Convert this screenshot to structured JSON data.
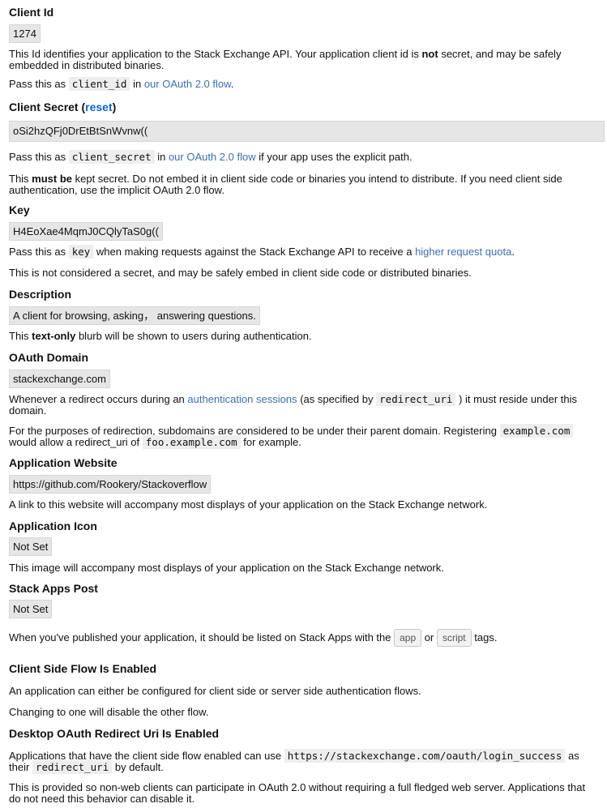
{
  "client_id": {
    "heading": "Client Id",
    "value": "1274",
    "desc_pre": "This Id identifies your application to the Stack Exchange API. Your application client id is ",
    "desc_bold": "not",
    "desc_post": " secret, and may be safely embedded in distributed binaries.",
    "pass_pre": "Pass this as",
    "pass_code": "client_id",
    "pass_in": "in",
    "pass_link": "our OAuth 2.0 flow",
    "pass_end": "."
  },
  "client_secret": {
    "heading": "Client Secret (",
    "reset_label": "reset",
    "heading_close": ")",
    "value": "oSi2hzQFj0DrEtBtSnWvnw((",
    "pass_pre": "Pass this as",
    "pass_code": "client_secret",
    "pass_in": "in",
    "pass_link": "our OAuth 2.0 flow",
    "pass_end": "if your app uses the explicit path.",
    "note_pre": "This ",
    "note_bold": "must be",
    "note_post": " kept secret. Do not embed it in client side code or binaries you intend to distribute. If you need client side authentication, use the implicit OAuth 2.0 flow."
  },
  "key": {
    "heading": "Key",
    "value": "H4EoXae4MqmJ0CQlyTaS0g((",
    "pass_pre": "Pass this as",
    "pass_code": "key",
    "pass_mid": "when making requests against the Stack Exchange API to receive a",
    "pass_link": "higher request quota",
    "pass_end": ".",
    "note": "This is not considered a secret, and may be safely embed in client side code or distributed binaries."
  },
  "description": {
    "heading": "Description",
    "value": "A client for browsing, asking， answering questions.",
    "note_pre": "This ",
    "note_bold": "text-only",
    "note_post": " blurb will be shown to users during authentication."
  },
  "oauth_domain": {
    "heading": "OAuth Domain",
    "value": "stackexchange.com",
    "p1_pre": "Whenever a redirect occurs during an",
    "p1_link": "authentication sessions",
    "p1_mid": "(as specified by",
    "p1_code": "redirect_uri",
    "p1_post": ") it must reside under this domain.",
    "p2_pre": "For the purposes of redirection, subdomains are considered to be under their parent domain. Registering",
    "p2_code1": "example.com",
    "p2_mid": "would allow a redirect_uri of",
    "p2_code2": "foo.example.com",
    "p2_post": "for example."
  },
  "website": {
    "heading": "Application Website",
    "value": "https://github.com/Rookery/Stackoverflow",
    "note": "A link to this website will accompany most displays of your application on the Stack Exchange network."
  },
  "icon": {
    "heading": "Application Icon",
    "value": "Not Set",
    "note": "This image will accompany most displays of your application on the Stack Exchange network."
  },
  "stack_apps": {
    "heading": "Stack Apps Post",
    "value": "Not Set",
    "note_pre": "When you've published your application, it should be listed on Stack Apps with the",
    "tag1": "app",
    "note_or": "or",
    "tag2": "script",
    "note_post": "tags."
  },
  "client_side": {
    "heading": "Client Side Flow Is Enabled",
    "p1": "An application can either be configured for client side or server side authentication flows.",
    "p2": "Changing to one will disable the other flow."
  },
  "desktop": {
    "heading": "Desktop OAuth Redirect Uri Is Enabled",
    "p1_pre": "Applications that have the client side flow enabled can use",
    "p1_code": "https://stackexchange.com/oauth/login_success",
    "p1_as": "as",
    "p1_their": "their",
    "p1_code2": "redirect_uri",
    "p1_post": "by default.",
    "p2": "This is provided so non-web clients can participate in OAuth 2.0 without requiring a full fledged web server. Applications that do not need this behavior can disable it."
  }
}
